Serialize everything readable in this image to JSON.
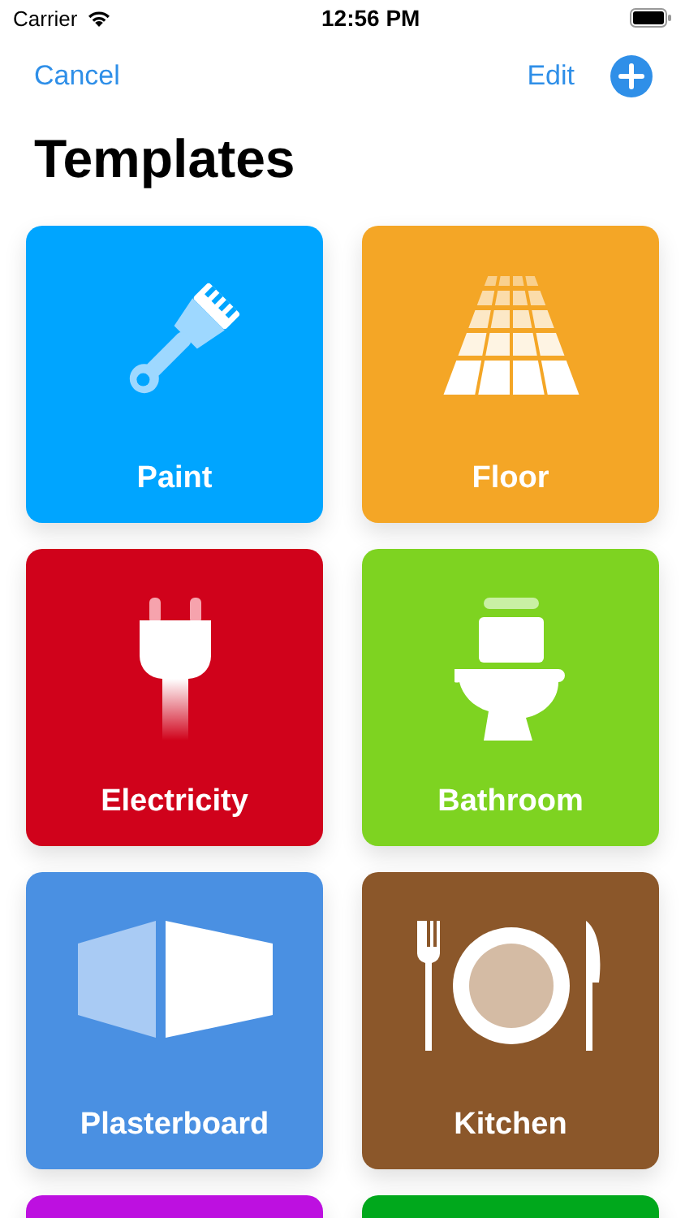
{
  "status_bar": {
    "carrier": "Carrier",
    "time": "12:56 PM"
  },
  "nav": {
    "left": "Cancel",
    "right": "Edit"
  },
  "title": "Templates",
  "tiles": [
    {
      "kind": "paint",
      "label": "Paint",
      "color": "#00a5ff"
    },
    {
      "kind": "floor",
      "label": "Floor",
      "color": "#f4a626"
    },
    {
      "kind": "electricity",
      "label": "Electricity",
      "color": "#d0021b"
    },
    {
      "kind": "bathroom",
      "label": "Bathroom",
      "color": "#7ed321"
    },
    {
      "kind": "plasterboard",
      "label": "Plasterboard",
      "color": "#4a90e2"
    },
    {
      "kind": "kitchen",
      "label": "Kitchen",
      "color": "#8b572a"
    },
    {
      "kind": "blank",
      "color": "#bd10e0"
    },
    {
      "kind": "blank",
      "color": "#00a81c"
    }
  ]
}
